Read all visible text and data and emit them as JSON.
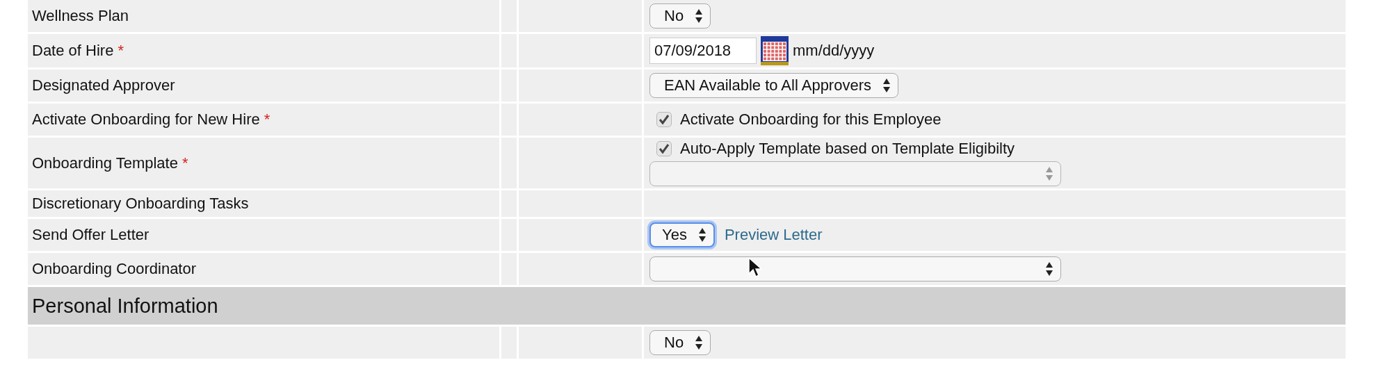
{
  "items": [
    {
      "kind": "field",
      "label": "Wellness Plan",
      "controls": [
        {
          "kind": "select",
          "value": "No",
          "disabled": false,
          "focused": false
        }
      ]
    },
    {
      "kind": "field",
      "label": "Date of Hire",
      "mark": "*",
      "controls": [
        {
          "kind": "date",
          "value": "07/09/2018",
          "hint": "mm/dd/yyyy"
        }
      ]
    },
    {
      "kind": "field",
      "label": "Designated Approver",
      "controls": [
        {
          "kind": "select",
          "value": "EAN Available to All Approvers",
          "disabled": false,
          "focused": false
        }
      ]
    },
    {
      "kind": "field",
      "label": "Activate Onboarding for New Hire",
      "mark": "*",
      "controls": [
        {
          "kind": "checkbox",
          "label": "Activate Onboarding for this Employee",
          "checked": true
        }
      ]
    },
    {
      "kind": "field",
      "label": "Onboarding Template",
      "mark": "*",
      "controls": [
        {
          "kind": "checkbox",
          "label": "Auto-Apply Template based on Template Eligibilty",
          "checked": true
        },
        {
          "kind": "select",
          "disabled": true,
          "focused": false
        }
      ]
    },
    {
      "kind": "field",
      "label": "Discretionary Onboarding Tasks"
    },
    {
      "kind": "field",
      "label": "Send Offer Letter",
      "controls": [
        {
          "kind": "select",
          "value": "Yes",
          "disabled": false,
          "focused": true
        },
        {
          "kind": "link",
          "label": "Preview Letter"
        }
      ]
    },
    {
      "kind": "field",
      "label": "Onboarding Coordinator",
      "pointer": true,
      "controls": [
        {
          "kind": "select",
          "disabled": false,
          "focused": false
        }
      ]
    },
    {
      "kind": "section",
      "label": "Personal Information"
    },
    {
      "kind": "field",
      "controls": [
        {
          "kind": "select",
          "value": "No",
          "disabled": false,
          "focused": false
        }
      ]
    }
  ]
}
